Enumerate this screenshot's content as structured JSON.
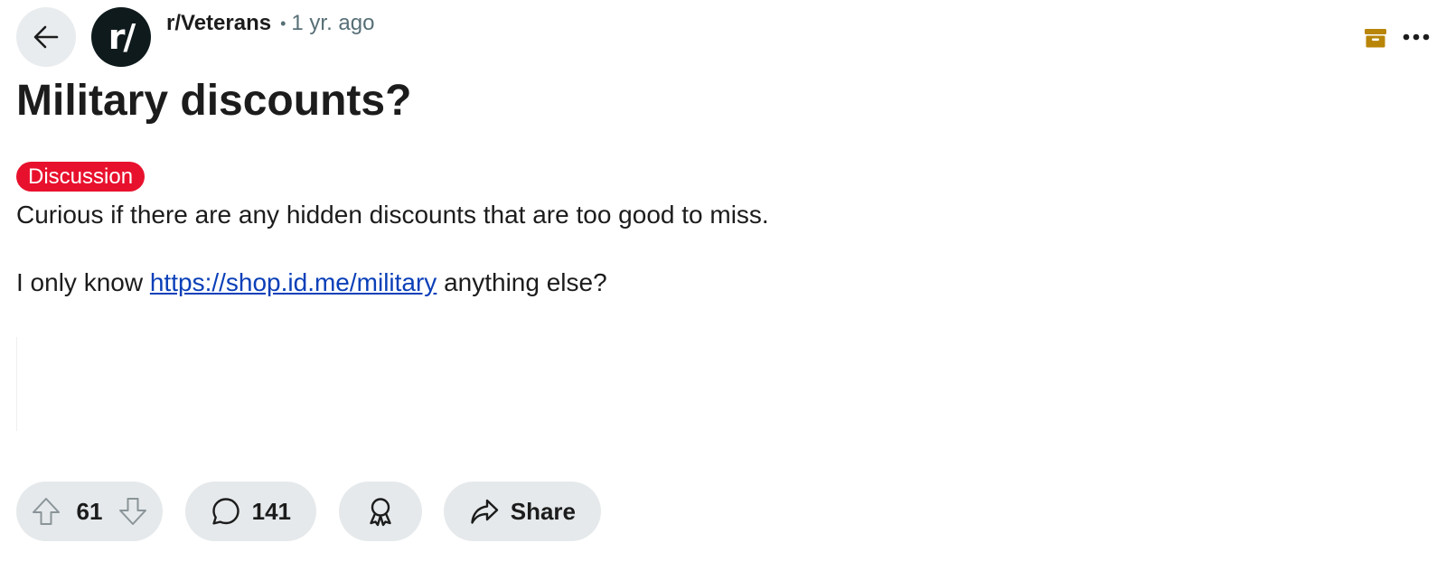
{
  "header": {
    "subreddit": "r/Veterans",
    "avatar_text": "r/",
    "separator": "•",
    "time_ago": "1 yr. ago",
    "icons": {
      "back": "arrow-left-icon",
      "archive": "archive-box-icon",
      "more": "more-horizontal-icon"
    },
    "archive_color": "#b88508"
  },
  "post": {
    "title": "Military discounts?",
    "flair": "Discussion",
    "flair_color": "#e8112d",
    "body_line1": "Curious if there are any hidden discounts that are too good to miss.",
    "body_line2_prefix": "I only know ",
    "body_link": "https://shop.id.me/military",
    "body_line2_suffix": " anything else?"
  },
  "actions": {
    "vote_count": "61",
    "comment_count": "141",
    "share_label": "Share",
    "icons": {
      "upvote": "arrow-up-outline-icon",
      "downvote": "arrow-down-outline-icon",
      "comment": "speech-bubble-icon",
      "award": "award-ribbon-icon",
      "share": "share-arrow-icon"
    }
  }
}
